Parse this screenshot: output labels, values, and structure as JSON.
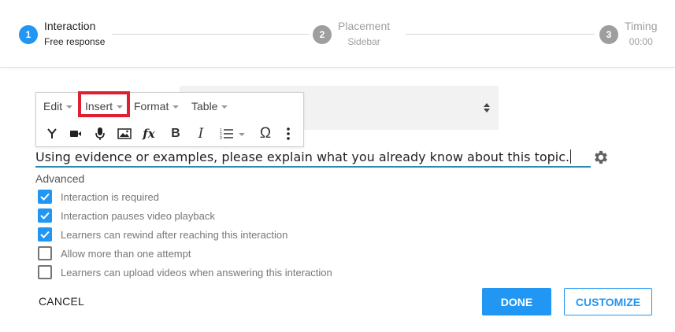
{
  "stepper": {
    "steps": [
      {
        "number": "1",
        "title": "Interaction",
        "subtitle": "Free response",
        "state": "active"
      },
      {
        "number": "2",
        "title": "Placement",
        "subtitle": "Sidebar",
        "state": "inactive"
      },
      {
        "number": "3",
        "title": "Timing",
        "subtitle": "00:00",
        "state": "inactive"
      }
    ]
  },
  "editor": {
    "menu": [
      "Edit",
      "Insert",
      "Format",
      "Table"
    ],
    "highlighted_menu": "Insert",
    "toolbar_icons": [
      "branch-icon",
      "video-icon",
      "microphone-icon",
      "image-icon",
      "formula-icon",
      "bold-icon",
      "italic-icon",
      "numbered-list-icon",
      "omega-icon",
      "more-vert-icon"
    ],
    "bold_glyph": "B",
    "italic_glyph": "I",
    "omega_glyph": "Ω",
    "formula_glyph": "fx"
  },
  "prompt": {
    "text": "Using evidence or examples, please explain what you already know about this topic."
  },
  "advanced": {
    "label": "Advanced",
    "options": [
      {
        "label": "Interaction is required",
        "checked": true
      },
      {
        "label": "Interaction pauses video playback",
        "checked": true
      },
      {
        "label": "Learners can rewind after reaching this interaction",
        "checked": true
      },
      {
        "label": "Allow more than one attempt",
        "checked": false
      },
      {
        "label": "Learners can upload videos when answering this interaction",
        "checked": false
      }
    ]
  },
  "footer": {
    "cancel_label": "CANCEL",
    "done_label": "DONE",
    "customize_label": "CUSTOMIZE"
  },
  "colors": {
    "accent": "#2196f3",
    "highlight": "#e02030",
    "inactive_step": "#9e9e9e"
  }
}
